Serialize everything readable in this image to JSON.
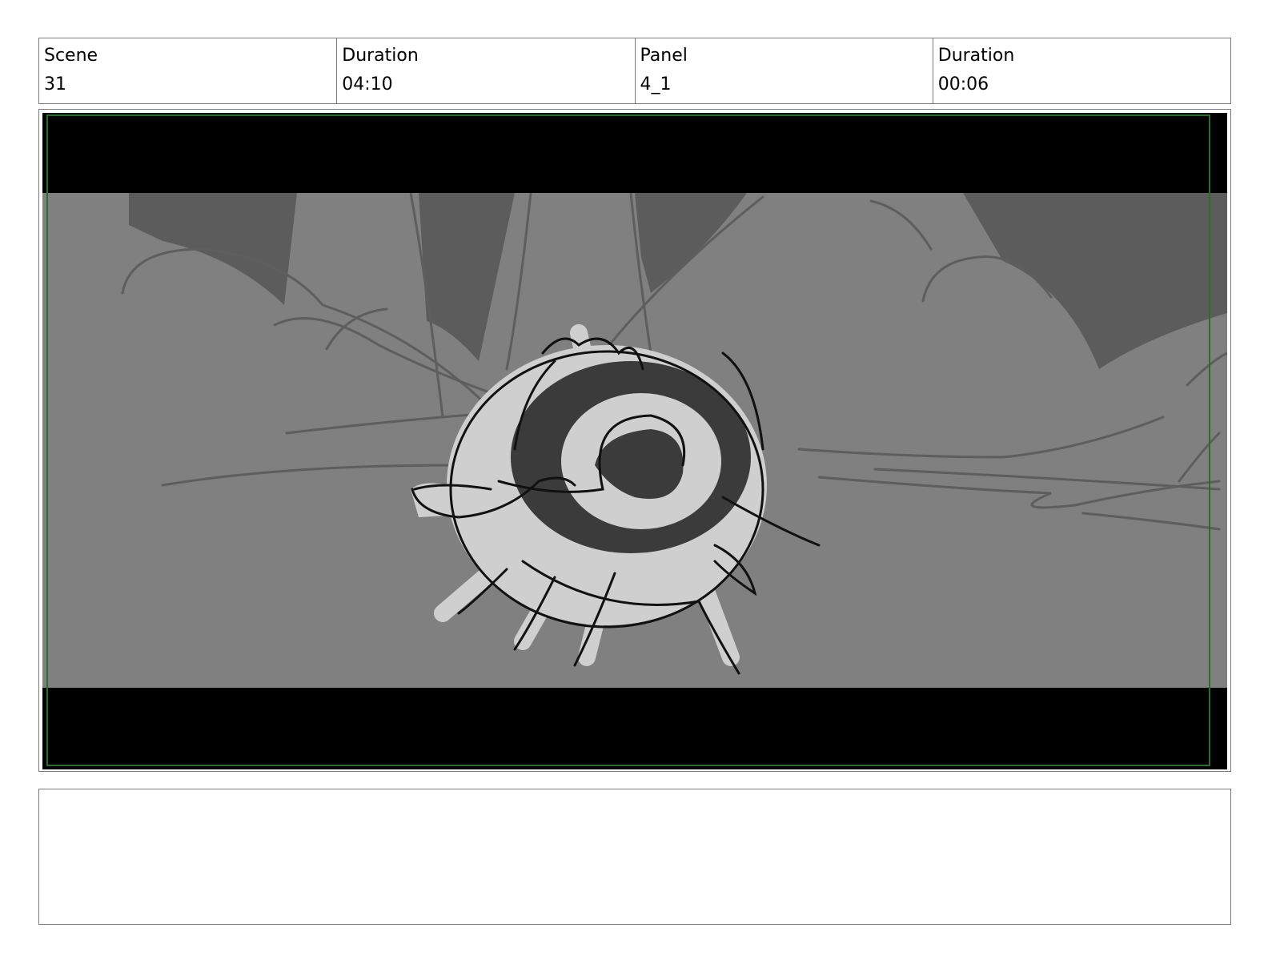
{
  "header": {
    "cells": [
      {
        "label": "Scene",
        "value": "31"
      },
      {
        "label": "Duration",
        "value": "04:10"
      },
      {
        "label": "Panel",
        "value": "4_1"
      },
      {
        "label": "Duration",
        "value": "00:06"
      }
    ]
  },
  "panel": {
    "letterbox_color": "#000000",
    "background_color": "#808080",
    "safe_frame_color": "#2e6b2e",
    "subject": "spiral-shell-sketch"
  },
  "notes": {
    "text": ""
  }
}
